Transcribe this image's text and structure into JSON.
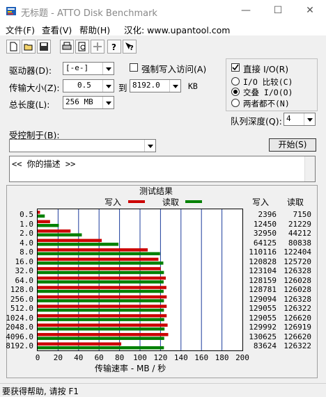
{
  "window": {
    "title": "无标题 - ATTO Disk Benchmark",
    "min": "—",
    "max": "☐",
    "close": "✕"
  },
  "menu": {
    "file": "文件(F)",
    "view": "查看(V)",
    "help": "帮助(H)",
    "credit": "汉化: www.upantool.com"
  },
  "toolbar": [
    "new-icon",
    "open-icon",
    "save-icon",
    "print-icon",
    "print-preview-icon",
    "move-icon",
    "help-icon",
    "context-help-icon"
  ],
  "form": {
    "drive_label": "驱动器(D):",
    "drive_value": "[-e-]",
    "force_write_label": "强制写入访问(A)",
    "force_write_checked": false,
    "direct_io_label": "直接 I/O(R)",
    "direct_io_checked": true,
    "transfer_label": "传输大小(Z):",
    "transfer_from": "0.5",
    "to_label": "到",
    "transfer_to": "8192.0",
    "kb_label": "KB",
    "length_label": "总长度(L):",
    "length_value": "256 MB",
    "io_compare_label": "I/O 比较(C)",
    "overlapped_io_label": "交叠 I/O(O)",
    "neither_label": "两者都不(N)",
    "selected_io_mode": "overlapped",
    "queue_label": "队列深度(Q):",
    "queue_value": "4",
    "controlled_by_label": "受控制于(B):",
    "controlled_by_value": "",
    "start_button": "开始(S)",
    "description": "<<  你的描述  >>"
  },
  "results": {
    "group_title": "测试结果",
    "write_legend": "写入",
    "read_legend": "读取",
    "write_col": "写入",
    "read_col": "读取",
    "xlabel": "传输速率 - MB / 秒",
    "write_color": "#cc0000",
    "read_color": "#008000"
  },
  "chart_data": {
    "type": "bar",
    "categories": [
      "0.5",
      "1.0",
      "2.0",
      "4.0",
      "8.0",
      "16.0",
      "32.0",
      "64.0",
      "128.0",
      "256.0",
      "512.0",
      "1024.0",
      "2048.0",
      "4096.0",
      "8192.0"
    ],
    "series": [
      {
        "name": "写入",
        "values": [
          2396,
          12450,
          32950,
          64125,
          110116,
          120828,
          123104,
          128159,
          128781,
          129094,
          129055,
          129055,
          129992,
          130625,
          83624
        ]
      },
      {
        "name": "读取",
        "values": [
          7150,
          21229,
          44212,
          80838,
          122404,
          125720,
          126328,
          126028,
          126028,
          126328,
          126322,
          126620,
          126919,
          126620,
          126322
        ]
      }
    ],
    "xlabel": "传输速率 - MB / 秒",
    "xticks": [
      "0",
      "20",
      "40",
      "60",
      "80",
      "100",
      "120",
      "140",
      "160",
      "180",
      "200"
    ],
    "xlim": [
      0,
      200
    ],
    "unit_note": "bar lengths in MB/s = value/1024",
    "grid": true,
    "legend": "top"
  },
  "status": "要获得帮助, 请按 F1"
}
